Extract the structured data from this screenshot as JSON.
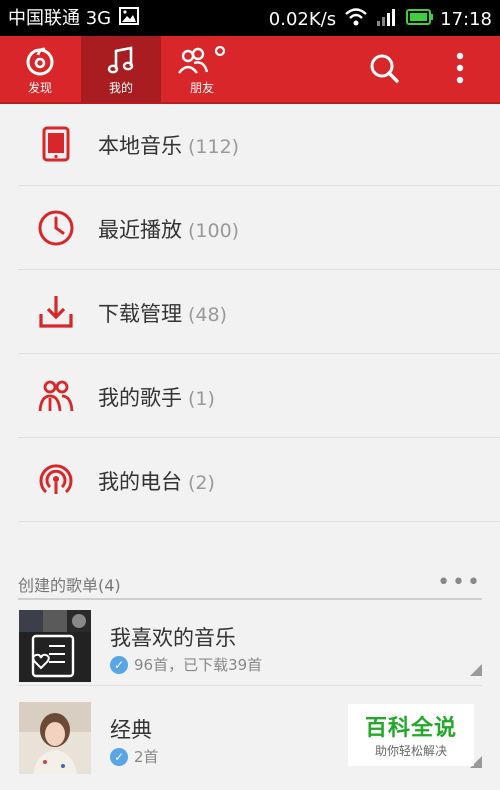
{
  "status_bar": {
    "carrier": "中国联通 3G",
    "speed": "0.02K/s",
    "time": "17:18"
  },
  "tabs": [
    {
      "label": "发现",
      "icon": "netease-music-logo-icon",
      "active": false
    },
    {
      "label": "我的",
      "icon": "music-note-icon",
      "active": true
    },
    {
      "label": "朋友",
      "icon": "friends-icon",
      "active": false
    }
  ],
  "toolbar": {
    "search_icon": "search-icon",
    "more_icon": "more-vertical-icon"
  },
  "menu": [
    {
      "label": "本地音乐",
      "count": "(112)",
      "icon": "phone-icon"
    },
    {
      "label": "最近播放",
      "count": "(100)",
      "icon": "clock-icon"
    },
    {
      "label": "下载管理",
      "count": "(48)",
      "icon": "download-icon"
    },
    {
      "label": "我的歌手",
      "count": "(1)",
      "icon": "singers-icon"
    },
    {
      "label": "我的电台",
      "count": "(2)",
      "icon": "radio-icon"
    }
  ],
  "playlist_section": {
    "title": "创建的歌单(4)"
  },
  "playlists": [
    {
      "name": "我喜欢的音乐",
      "meta": "96首，已下载39首"
    },
    {
      "name": "经典",
      "meta": "2首"
    }
  ],
  "watermark": {
    "title": "百科全说",
    "subtitle": "助你轻松解决"
  },
  "colors": {
    "brand_red": "#d9262a",
    "active_tab": "#a91c1f",
    "check_blue": "#5aa5e6"
  }
}
